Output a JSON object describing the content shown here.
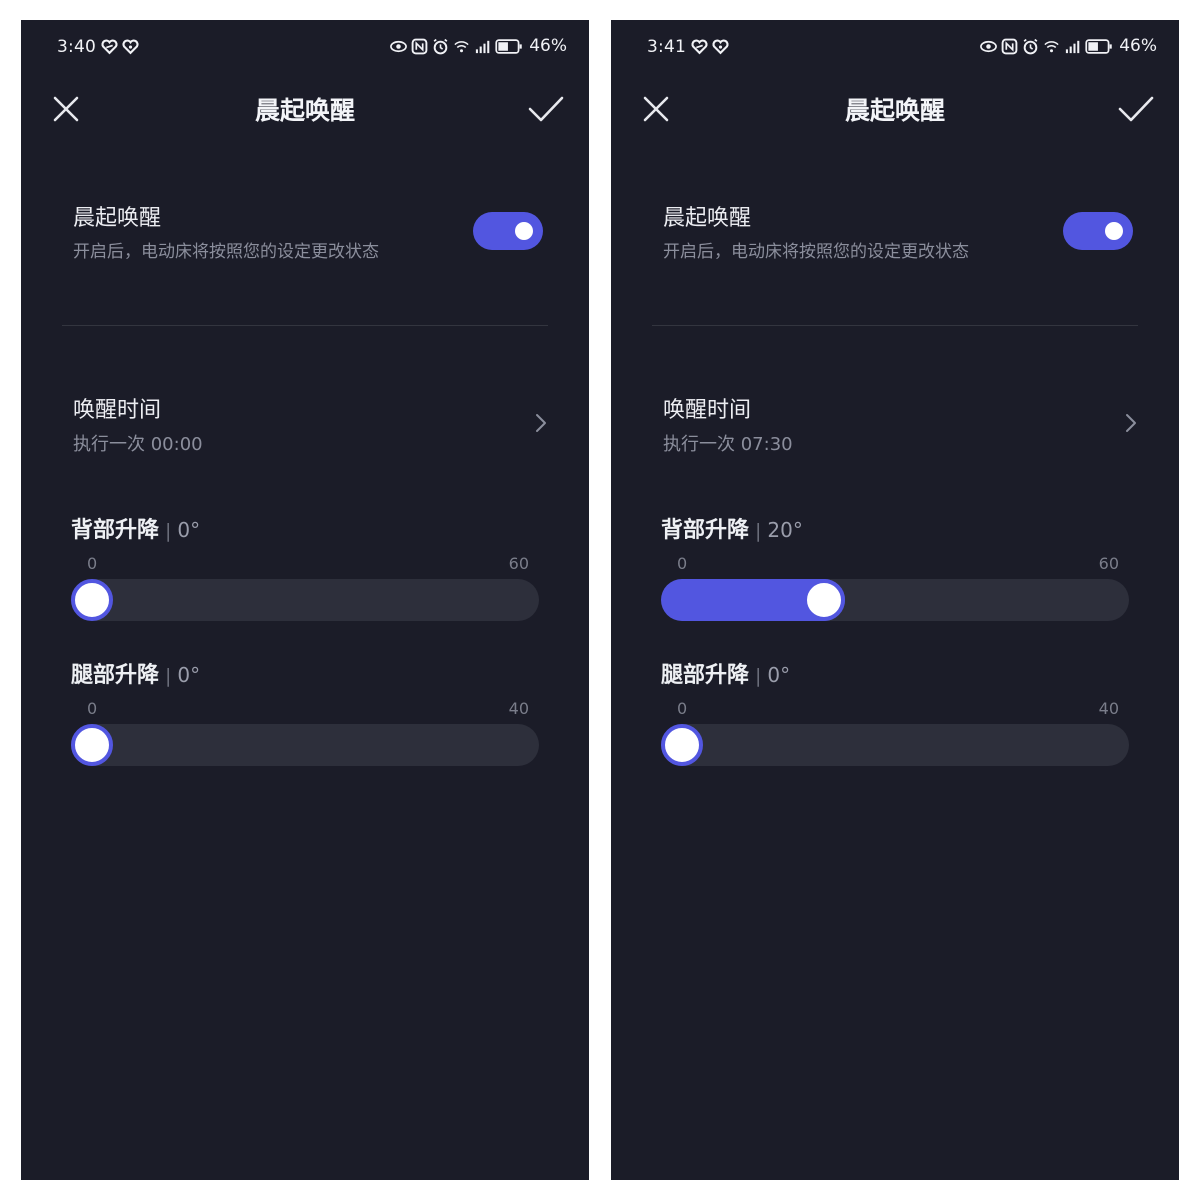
{
  "screens": [
    {
      "status_time": "3:40",
      "battery": "46%",
      "title": "晨起唤醒",
      "wake": {
        "label": "晨起唤醒",
        "description": "开启后，电动床将按照您的设定更改状态",
        "enabled": true
      },
      "wake_time": {
        "label": "唤醒时间",
        "value": "执行一次 00:00"
      },
      "back": {
        "title": "背部升降",
        "sep": "|",
        "value": "0°",
        "min": "0",
        "max": "60",
        "level": 0
      },
      "leg": {
        "title": "腿部升降",
        "sep": "|",
        "value": "0°",
        "min": "0",
        "max": "40",
        "level": 0
      }
    },
    {
      "status_time": "3:41",
      "battery": "46%",
      "title": "晨起唤醒",
      "wake": {
        "label": "晨起唤醒",
        "description": "开启后，电动床将按照您的设定更改状态",
        "enabled": true
      },
      "wake_time": {
        "label": "唤醒时间",
        "value": "执行一次 07:30"
      },
      "back": {
        "title": "背部升降",
        "sep": "|",
        "value": "20°",
        "min": "0",
        "max": "60",
        "level": 20
      },
      "leg": {
        "title": "腿部升降",
        "sep": "|",
        "value": "0°",
        "min": "0",
        "max": "40",
        "level": 0
      }
    }
  ],
  "colors": {
    "accent": "#5256e0",
    "background": "#1b1c28",
    "track": "#2d2f3b"
  }
}
